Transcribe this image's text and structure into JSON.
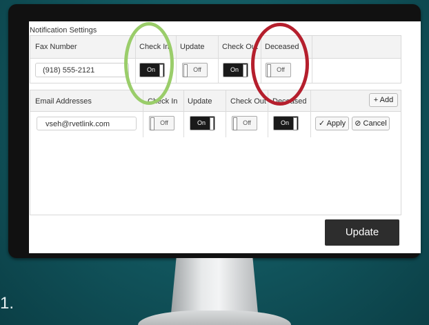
{
  "notification": {
    "title": "Notification Settings",
    "fax_header": {
      "fax_number": "Fax Number",
      "check_in": "Check In",
      "update": "Update",
      "check_out": "Check Out",
      "deceased": "Deceased"
    },
    "fax_value": "(918) 555-2121",
    "fax_toggles": {
      "check_in": "On",
      "update": "Off",
      "check_out": "On",
      "deceased": "Off"
    }
  },
  "email": {
    "header": {
      "email_addresses": "Email Addresses",
      "check_in": "Check In",
      "update": "Update",
      "check_out": "Check Out",
      "deceased": "Deceased",
      "add": "+ Add"
    },
    "email_value": "vseh@rvetlink.com",
    "toggles": {
      "check_in": "Off",
      "update": "On",
      "check_out": "Off",
      "deceased": "On"
    },
    "apply": "✓ Apply",
    "cancel": "⊘ Cancel"
  },
  "update_button": "Update",
  "corner_text": "1."
}
